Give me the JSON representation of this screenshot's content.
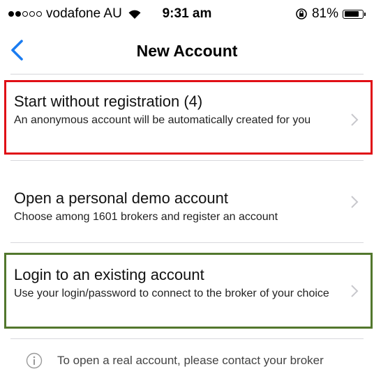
{
  "status_bar": {
    "carrier": "vodafone AU",
    "time": "9:31 am",
    "battery": "81%",
    "battery_level": 0.81,
    "signal_bars_filled": 2,
    "signal_bars_total": 5,
    "icons": [
      "signal-dots-icon",
      "wifi-icon",
      "rotation-lock-icon",
      "battery-icon"
    ]
  },
  "nav": {
    "title": "New Account",
    "back_icon": "chevron-left-icon",
    "accent_color": "#1a7cf0"
  },
  "options": [
    {
      "title": "Start without registration (4)",
      "description": "An anonymous account will be automatically created for you",
      "highlight_color": "#e00f16"
    },
    {
      "title": "Open a personal demo account",
      "description": "Choose among 1601 brokers and register an account"
    },
    {
      "title": "Login to an existing account",
      "description": "Use your login/password to connect to the broker of your choice",
      "highlight_color": "#52772d"
    }
  ],
  "info": {
    "icon": "info-icon",
    "text": "To open a real account, please contact your broker"
  }
}
